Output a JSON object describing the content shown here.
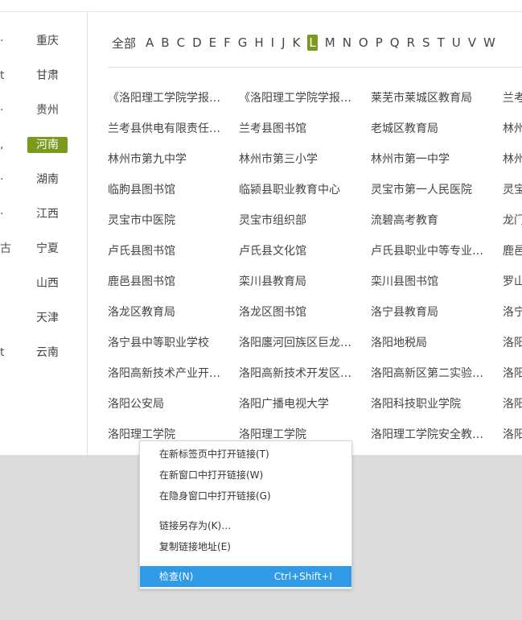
{
  "provinces": {
    "cut_left": [
      "·",
      "t",
      "·",
      ",",
      "·",
      "·",
      "古",
      "",
      "",
      "t"
    ],
    "items": [
      "重庆",
      "甘肃",
      "贵州",
      "河南",
      "湖南",
      "江西",
      "宁夏",
      "山西",
      "天津",
      "云南"
    ],
    "active_index": 3
  },
  "alphabet": {
    "all_label": "全部",
    "letters": [
      "A",
      "B",
      "C",
      "D",
      "E",
      "F",
      "G",
      "H",
      "I",
      "J",
      "K",
      "L",
      "M",
      "N",
      "O",
      "P",
      "Q",
      "R",
      "S",
      "T",
      "U",
      "V",
      "W"
    ],
    "active_letter": "L"
  },
  "organizations": [
    [
      "《洛阳理工学院学报(…",
      "《洛阳理工学院学报(…",
      "莱芜市莱城区教育局",
      "兰考"
    ],
    [
      "兰考县供电有限责任…",
      "兰考县图书馆",
      "老城区教育局",
      "林州"
    ],
    [
      "林州市第九中学",
      "林州市第三小学",
      "林州市第一中学",
      "林州"
    ],
    [
      "临朐县图书馆",
      "临颍县职业教育中心",
      "灵宝市第一人民医院",
      "灵宝"
    ],
    [
      "灵宝市中医院",
      "灵宝市组织部",
      "流碧高考教育",
      "龙门"
    ],
    [
      "卢氏县图书馆",
      "卢氏县文化馆",
      "卢氏县职业中等专业…",
      "鹿邑"
    ],
    [
      "鹿邑县图书馆",
      "栾川县教育局",
      "栾川县图书馆",
      "罗山"
    ],
    [
      "洛龙区教育局",
      "洛龙区图书馆",
      "洛宁县教育局",
      "洛宁"
    ],
    [
      "洛宁县中等职业学校",
      "洛阳廛河回族区巨龙…",
      "洛阳地税局",
      "洛阳"
    ],
    [
      "洛阳高新技术产业开…",
      "洛阳高新技术开发区…",
      "洛阳高新区第二实验…",
      "洛阳"
    ],
    [
      "洛阳公安局",
      "洛阳广播电视大学",
      "洛阳科技职业学院",
      "洛阳"
    ],
    [
      "洛阳理工学院",
      "洛阳理工学院",
      "洛阳理工学院安全教…",
      "洛阳"
    ]
  ],
  "context_menu": {
    "open_new_tab": "在新标签页中打开链接(T)",
    "open_new_window": "在新窗口中打开链接(W)",
    "open_incognito": "在隐身窗口中打开链接(G)",
    "save_link_as": "链接另存为(K)…",
    "copy_link": "复制链接地址(E)",
    "inspect": "检查(N)",
    "inspect_shortcut": "Ctrl+Shift+I"
  },
  "colors": {
    "accent_green": "#7a9a1e",
    "menu_highlight": "#2f9ae6"
  }
}
